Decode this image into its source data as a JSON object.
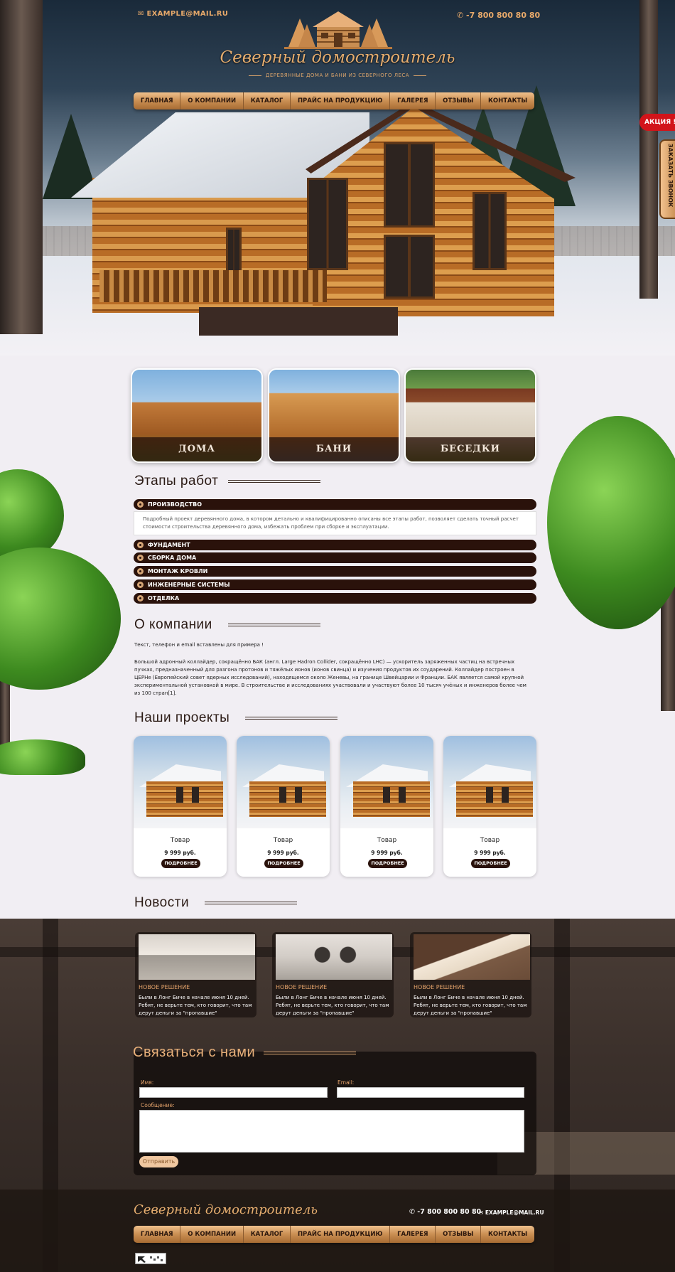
{
  "header": {
    "email": "EXAMPLE@MAIL.RU",
    "phone": "-7 800 800 80 80",
    "logo_title": "Северный домостроитель",
    "logo_subtitle": "ДЕРЕВЯННЫЕ ДОМА И БАНИ ИЗ СЕВЕРНОГО ЛЕСА"
  },
  "nav": {
    "items": [
      "ГЛАВНАЯ",
      "О КОМПАНИИ",
      "КАТАЛОГ",
      "ПРАЙС НА ПРОДУКЦИЮ",
      "ГАЛЕРЕЯ",
      "ОТЗЫВЫ",
      "КОНТАКТЫ"
    ]
  },
  "side": {
    "promo": "АКЦИЯ !",
    "callback": "ЗАКАЗАТЬ ЗВОНОК"
  },
  "categories": [
    "ДОМА",
    "БАНИ",
    "БЕСЕДКИ"
  ],
  "stages": {
    "title": "Этапы работ",
    "items": [
      "ПРОИЗВОДСТВО",
      "ФУНДАМЕНТ",
      "СБОРКА ДОМА",
      "МОНТАЖ КРОВЛИ",
      "ИНЖЕНЕРНЫЕ СИСТЕМЫ",
      "ОТДЕЛКА"
    ],
    "open_text": "Подробный проект деревянного дома, в котором детально и квалифицированно описаны все этапы работ, позволяет сделать точный расчет стоимости строительства деревянного дома, избежать проблем при сборке и эксплуатации."
  },
  "about": {
    "title": "О компании",
    "note": "Текст, телефон и email вставлены для примера !",
    "body": "Большой адронный коллайдер, сокращённо БАК (англ. Large Hadron Collider, сокращённо LHC) — ускоритель заряженных частиц на встречных пучках, предназначенный для разгона протонов и тяжёлых ионов (ионов свинца) и изучения продуктов их соударений. Коллайдер построен в ЦЕРНе (Европейский совет ядерных исследований), находящемся около Женевы, на границе Швейцарии и Франции. БАК является самой крупной экспериментальной установкой в мире. В строительстве и исследованиях участвовали и участвуют более 10 тысяч учёных и инженеров более чем из 100 стран[1]."
  },
  "projects": {
    "title": "Наши проекты",
    "items": [
      {
        "name": "Товар",
        "price": "9 999 руб.",
        "button": "ПОДРОБНЕЕ"
      },
      {
        "name": "Товар",
        "price": "9 999 руб.",
        "button": "ПОДРОБНЕЕ"
      },
      {
        "name": "Товар",
        "price": "9 999 руб.",
        "button": "ПОДРОБНЕЕ"
      },
      {
        "name": "Товар",
        "price": "9 999 руб.",
        "button": "ПОДРОБНЕЕ"
      }
    ]
  },
  "news": {
    "title": "Новости",
    "items": [
      {
        "title": "НОВОЕ РЕШЕНИЕ",
        "text": "Были в Лонг Биче в начале июня 10 дней. Ребят, не верьте тем, кто говорит, что там дерут деньги за \"пропавшие\""
      },
      {
        "title": "НОВОЕ РЕШЕНИЕ",
        "text": "Были в Лонг Биче в начале июня 10 дней. Ребят, не верьте тем, кто говорит, что там дерут деньги за \"пропавшие\""
      },
      {
        "title": "НОВОЕ РЕШЕНИЕ",
        "text": "Были в Лонг Биче в начале июня 10 дней. Ребят, не верьте тем, кто говорит, что там дерут деньги за \"пропавшие\""
      }
    ]
  },
  "contact": {
    "title": "Связаться с нами",
    "name_label": "Имя:",
    "email_label": "Email:",
    "message_label": "Сообщение:",
    "submit": "Отправить"
  },
  "footer": {
    "logo": "Северный домостроитель",
    "phone": "-7 800 800 80 80",
    "email": "EXAMPLE@MAIL.RU"
  }
}
